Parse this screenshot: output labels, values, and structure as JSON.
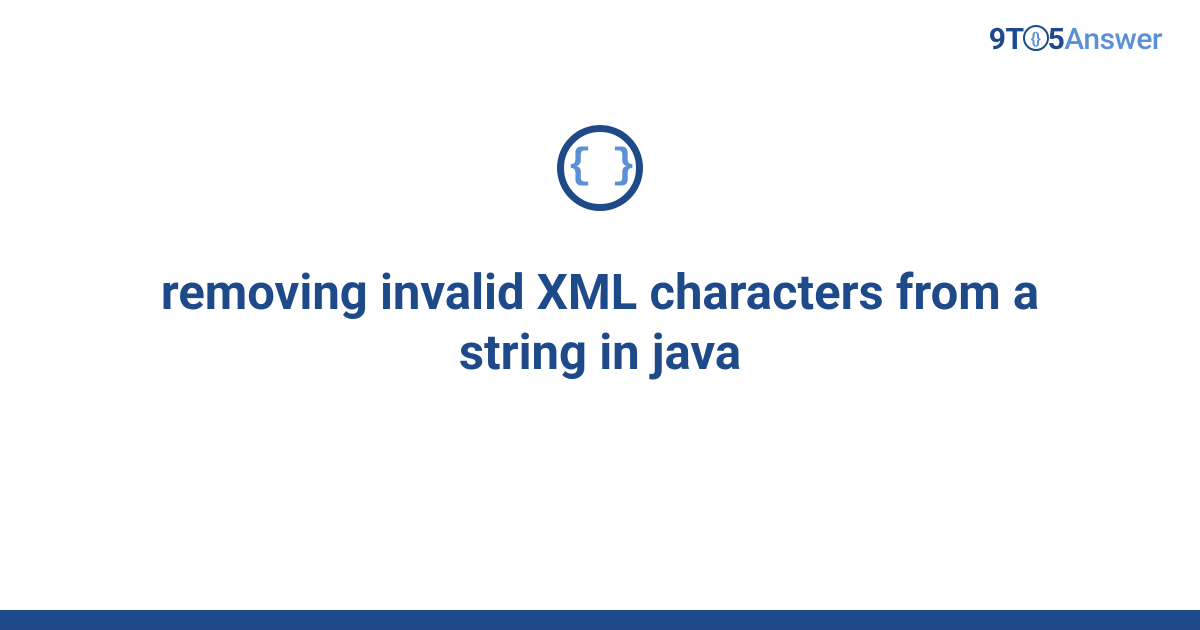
{
  "brand": {
    "part1": "9T",
    "circle_text": "{}",
    "part2": "5",
    "part3": "Answer"
  },
  "icon": {
    "braces": "{ }"
  },
  "title": "removing invalid XML characters from a string in java",
  "colors": {
    "primary": "#1e4a8a",
    "secondary": "#5b8fd6",
    "background": "#ffffff"
  }
}
